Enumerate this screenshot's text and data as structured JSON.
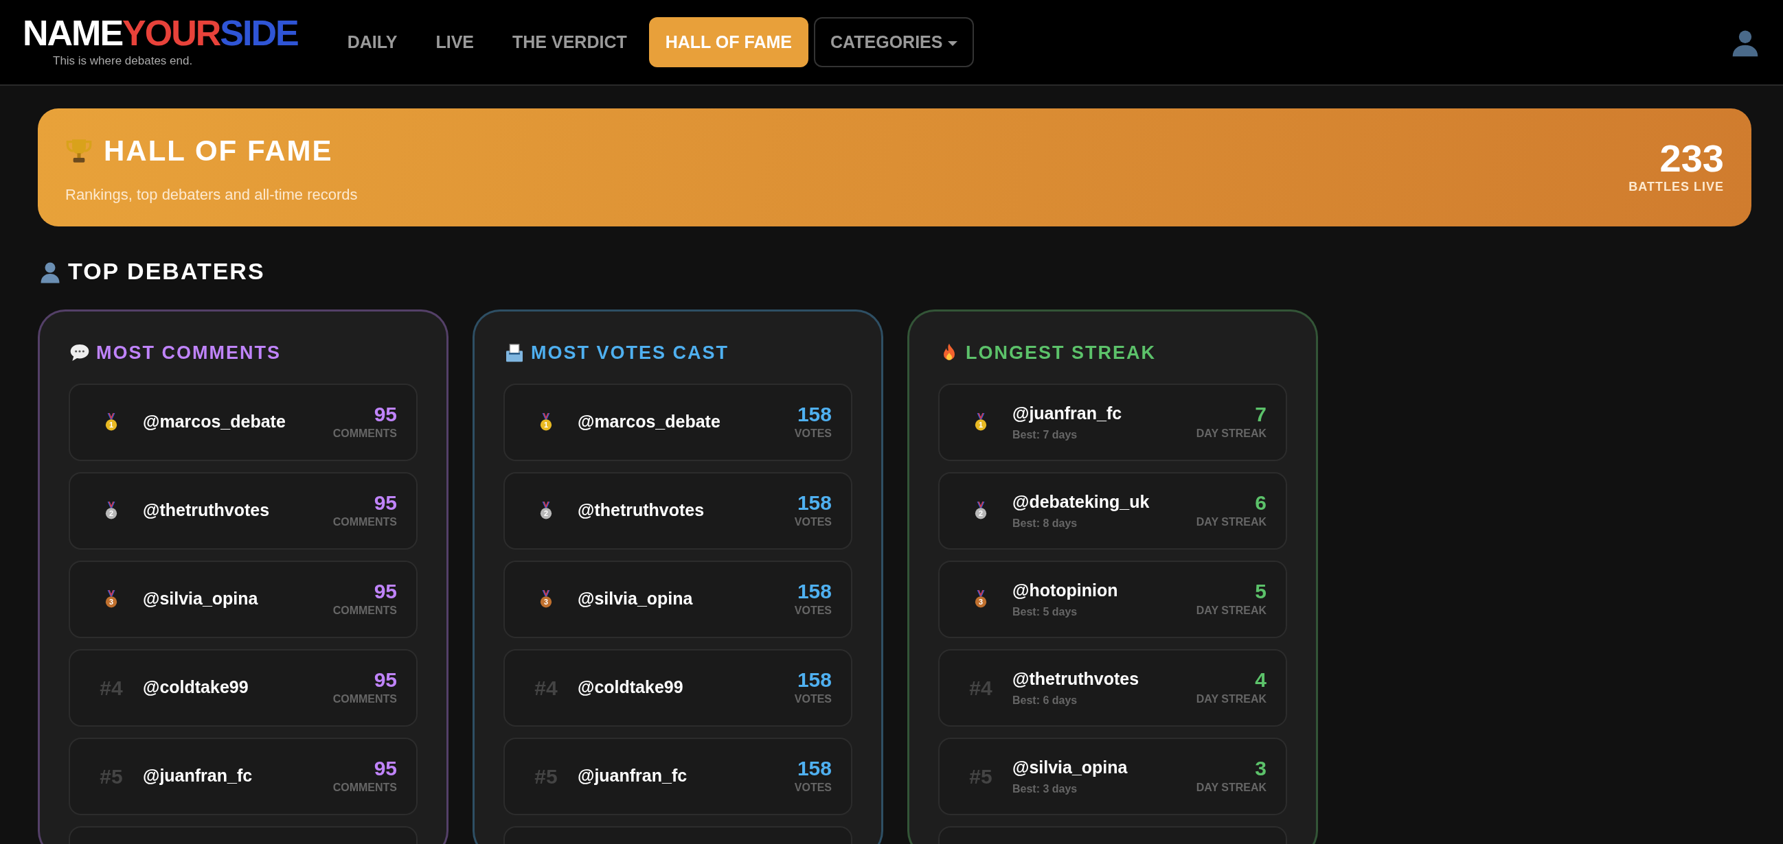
{
  "header": {
    "logo": {
      "part_1": "NAME",
      "part_2": "YOUR",
      "part_3": "SIDE",
      "tagline": "This is where debates end."
    },
    "nav": [
      {
        "label": "DAILY",
        "selected": false,
        "kind": "link"
      },
      {
        "label": "LIVE",
        "selected": false,
        "kind": "link"
      },
      {
        "label": "THE VERDICT",
        "selected": false,
        "kind": "link"
      },
      {
        "label": "HALL OF FAME",
        "selected": true,
        "kind": "link"
      },
      {
        "label": "CATEGORIES",
        "selected": false,
        "kind": "dropdown"
      }
    ]
  },
  "banner": {
    "title": "HALL OF FAME",
    "subtitle": "Rankings, top debaters and all-time records",
    "count": "233",
    "count_label": "BATTLES LIVE"
  },
  "section": {
    "title": "TOP DEBATERS"
  },
  "boards": [
    {
      "title": "MOST COMMENTS",
      "kind": "comments",
      "color": "#c084fc",
      "more_below": true,
      "rows": [
        {
          "kind": "medal",
          "rank": "1",
          "color": "#e8b923",
          "user": "@marcos_debate",
          "value": "95",
          "unit": "COMMENTS"
        },
        {
          "kind": "medal",
          "rank": "2",
          "color": "#b8b8b8",
          "user": "@thetruthvotes",
          "value": "95",
          "unit": "COMMENTS"
        },
        {
          "kind": "medal",
          "rank": "3",
          "color": "#c0702e",
          "user": "@silvia_opina",
          "value": "95",
          "unit": "COMMENTS"
        },
        {
          "kind": "number",
          "rank": "#4",
          "user": "@coldtake99",
          "value": "95",
          "unit": "COMMENTS"
        },
        {
          "kind": "number",
          "rank": "#5",
          "user": "@juanfran_fc",
          "value": "95",
          "unit": "COMMENTS"
        }
      ]
    },
    {
      "title": "MOST VOTES CAST",
      "kind": "votes",
      "color": "#4fb0f0",
      "more_below": true,
      "rows": [
        {
          "kind": "medal",
          "rank": "1",
          "color": "#e8b923",
          "user": "@marcos_debate",
          "value": "158",
          "unit": "VOTES"
        },
        {
          "kind": "medal",
          "rank": "2",
          "color": "#b8b8b8",
          "user": "@thetruthvotes",
          "value": "158",
          "unit": "VOTES"
        },
        {
          "kind": "medal",
          "rank": "3",
          "color": "#c0702e",
          "user": "@silvia_opina",
          "value": "158",
          "unit": "VOTES"
        },
        {
          "kind": "number",
          "rank": "#4",
          "user": "@coldtake99",
          "value": "158",
          "unit": "VOTES"
        },
        {
          "kind": "number",
          "rank": "#5",
          "user": "@juanfran_fc",
          "value": "158",
          "unit": "VOTES"
        }
      ]
    },
    {
      "title": "LONGEST STREAK",
      "kind": "streak",
      "color": "#5cc26a",
      "more_below": true,
      "rows": [
        {
          "kind": "medal",
          "rank": "1",
          "color": "#e8b923",
          "user": "@juanfran_fc",
          "detail": "Best: 7 days",
          "value": "7",
          "unit": "DAY STREAK"
        },
        {
          "kind": "medal",
          "rank": "2",
          "color": "#b8b8b8",
          "user": "@debateking_uk",
          "detail": "Best: 8 days",
          "value": "6",
          "unit": "DAY STREAK"
        },
        {
          "kind": "medal",
          "rank": "3",
          "color": "#c0702e",
          "user": "@hotopinion",
          "detail": "Best: 5 days",
          "value": "5",
          "unit": "DAY STREAK"
        },
        {
          "kind": "number",
          "rank": "#4",
          "user": "@thetruthvotes",
          "detail": "Best: 6 days",
          "value": "4",
          "unit": "DAY STREAK"
        },
        {
          "kind": "number",
          "rank": "#5",
          "user": "@silvia_opina",
          "detail": "Best: 3 days",
          "value": "3",
          "unit": "DAY STREAK"
        }
      ]
    }
  ]
}
